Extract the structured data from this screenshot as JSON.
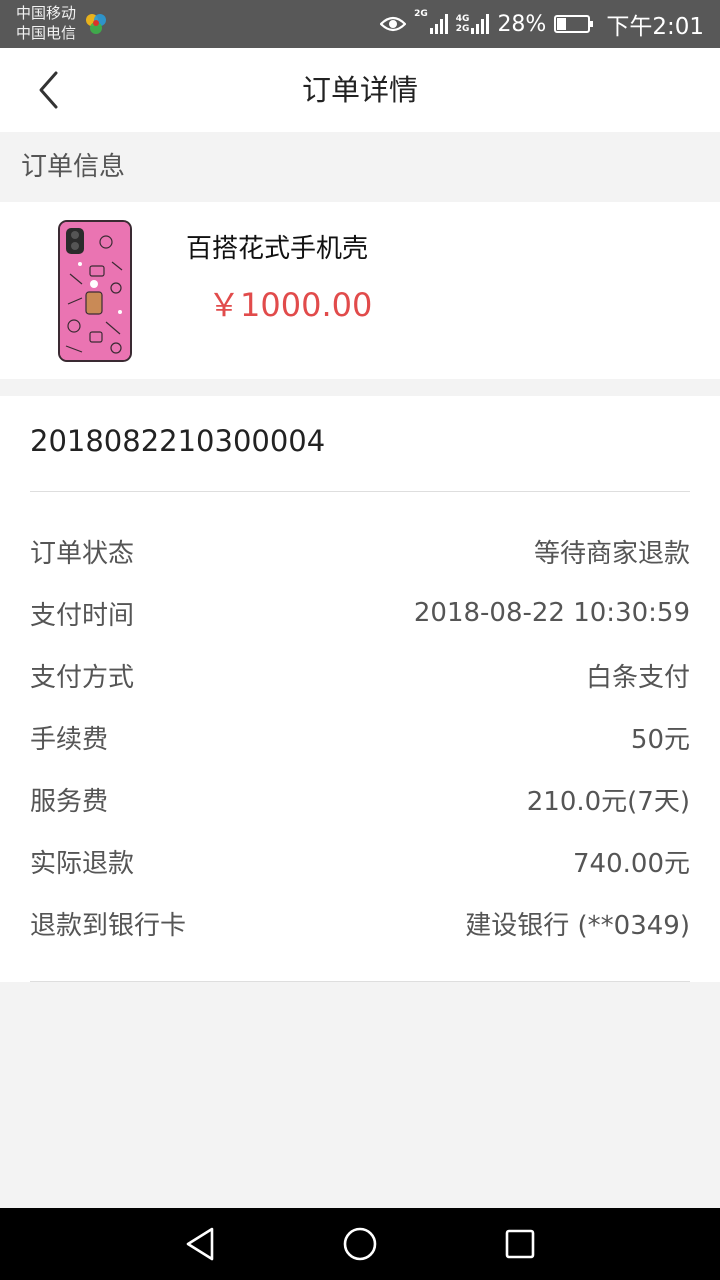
{
  "status_bar": {
    "carrier_1": "中国移动",
    "carrier_2": "中国电信",
    "eye_icon": "eye-icon",
    "signal_1_label": "2G",
    "signal_2_label_a": "4G",
    "signal_2_label_b": "2G",
    "battery_percent": "28%",
    "time": "下午2:01"
  },
  "header": {
    "title": "订单详情",
    "back_icon": "chevron-left-icon"
  },
  "section": {
    "label": "订单信息"
  },
  "product": {
    "name": "百搭花式手机壳",
    "price": "￥1000.00",
    "price_color": "#e14b4b"
  },
  "order": {
    "number": "2018082210300004",
    "rows": [
      {
        "label": "订单状态",
        "value": "等待商家退款"
      },
      {
        "label": "支付时间",
        "value": "2018-08-22 10:30:59"
      },
      {
        "label": "支付方式",
        "value": "白条支付"
      },
      {
        "label": "手续费",
        "value": "50元"
      },
      {
        "label": "服务费",
        "value": "210.0元(7天)"
      },
      {
        "label": "实际退款",
        "value": "740.00元"
      },
      {
        "label": "退款到银行卡",
        "value": "建设银行 (**0349)"
      }
    ]
  },
  "nav": {
    "back": "triangle-back-icon",
    "home": "circle-home-icon",
    "recents": "square-recents-icon"
  }
}
